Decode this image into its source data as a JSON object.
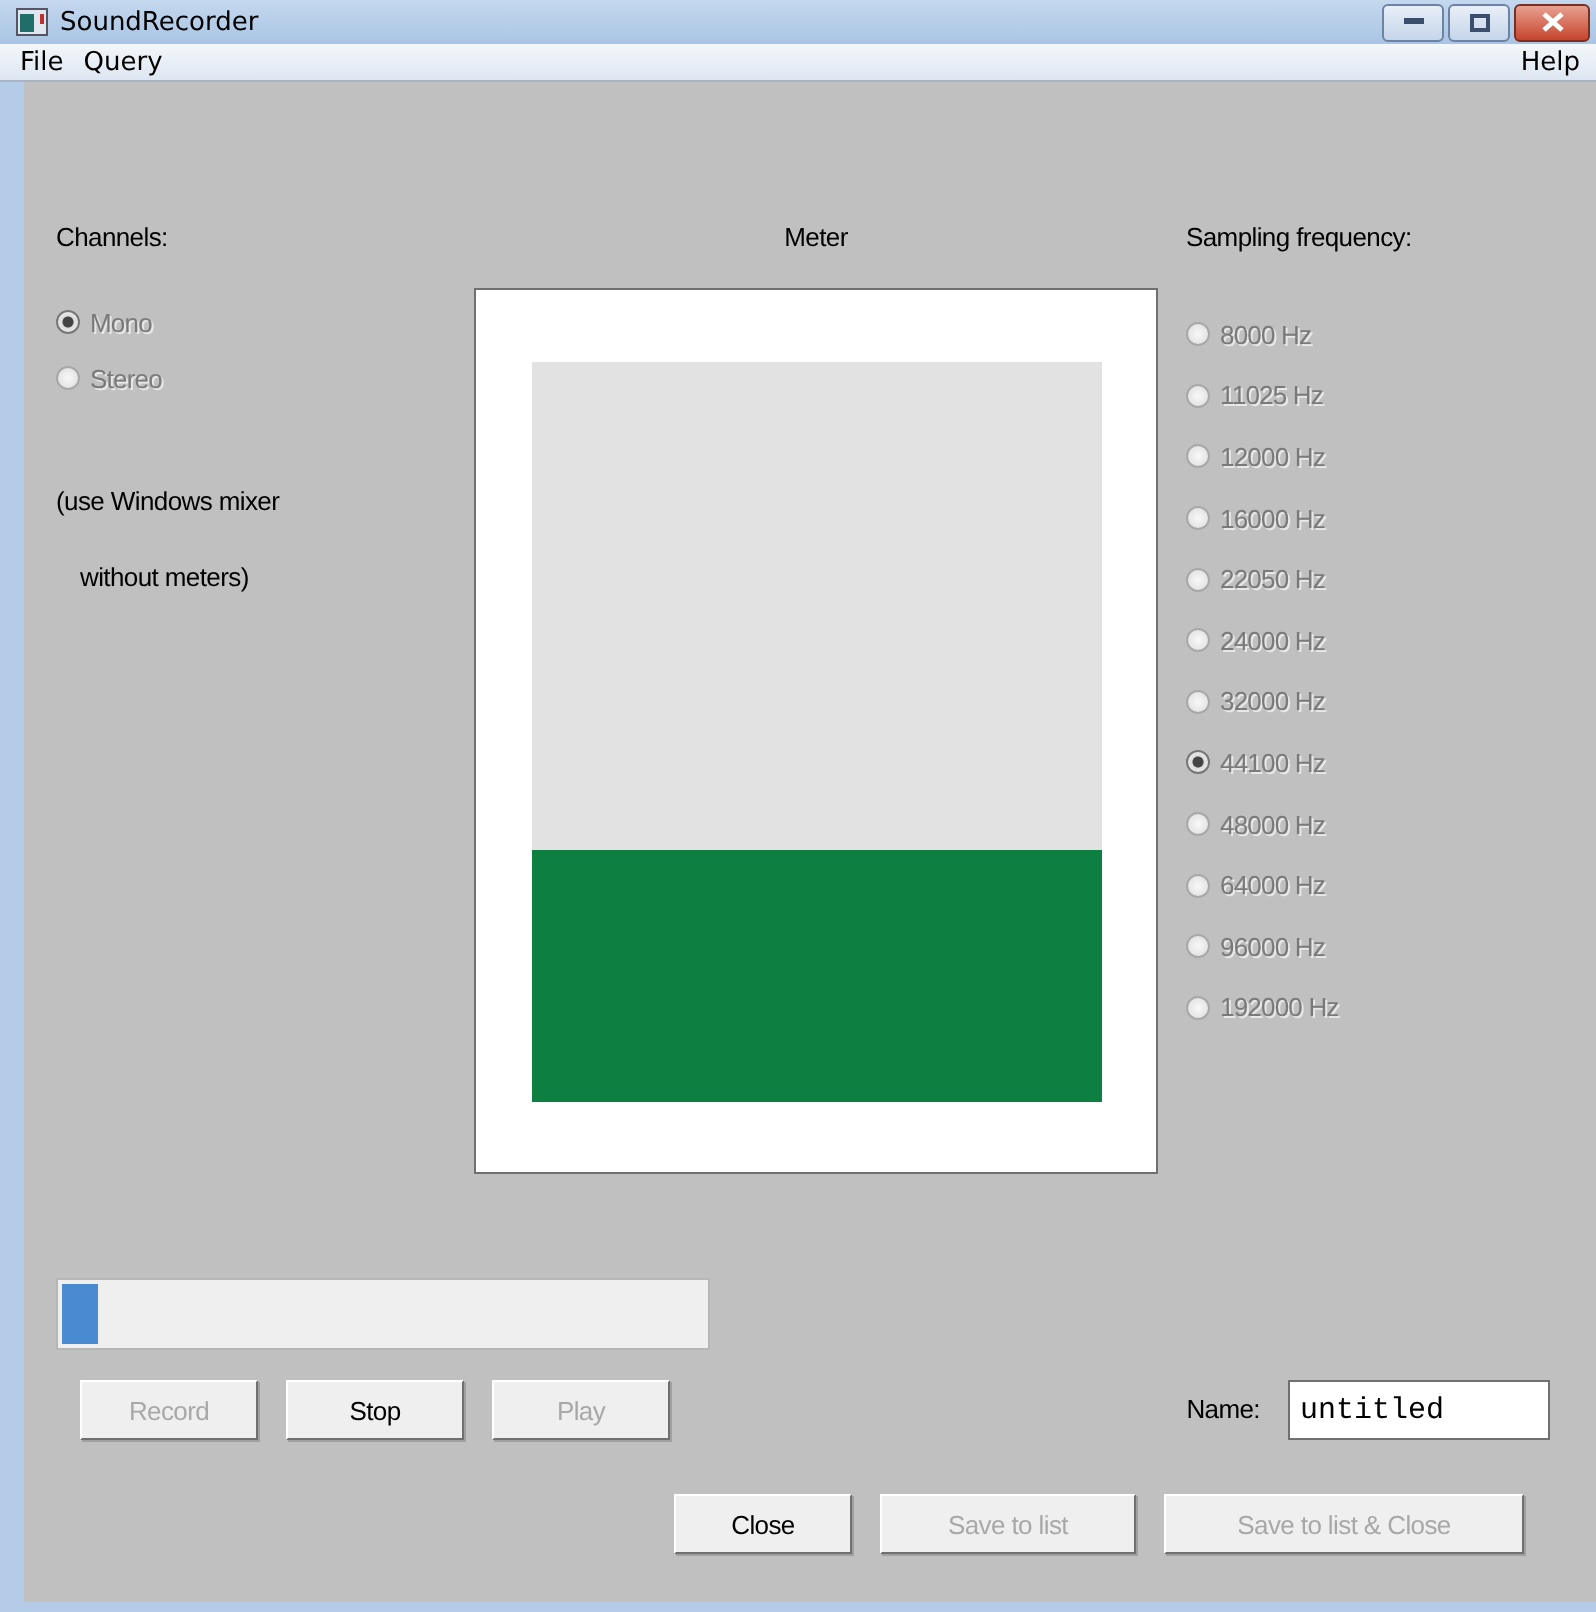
{
  "window": {
    "title": "SoundRecorder"
  },
  "menu": [
    "File",
    "Query"
  ],
  "help_menu": "Help",
  "channels": {
    "label": "Channels:",
    "options": [
      {
        "label": "Mono",
        "selected": true,
        "disabled": true
      },
      {
        "label": "Stereo",
        "selected": false,
        "disabled": true
      }
    ],
    "note": [
      "(use Windows mixer",
      "without meters)"
    ]
  },
  "meter": {
    "label": "Meter",
    "level": 0.34
  },
  "sampling": {
    "label": "Sampling frequency:",
    "options": [
      {
        "label": "8000 Hz",
        "selected": false,
        "disabled": true
      },
      {
        "label": "11025 Hz",
        "selected": false,
        "disabled": true
      },
      {
        "label": "12000 Hz",
        "selected": false,
        "disabled": true
      },
      {
        "label": "16000 Hz",
        "selected": false,
        "disabled": true
      },
      {
        "label": "22050 Hz",
        "selected": false,
        "disabled": true
      },
      {
        "label": "24000 Hz",
        "selected": false,
        "disabled": true
      },
      {
        "label": "32000 Hz",
        "selected": false,
        "disabled": true
      },
      {
        "label": "44100 Hz",
        "selected": true,
        "disabled": true
      },
      {
        "label": "48000 Hz",
        "selected": false,
        "disabled": true
      },
      {
        "label": "64000 Hz",
        "selected": false,
        "disabled": true
      },
      {
        "label": "96000 Hz",
        "selected": false,
        "disabled": true
      },
      {
        "label": "192000 Hz",
        "selected": false,
        "disabled": true
      }
    ]
  },
  "progress": {
    "level": 0.055
  },
  "transport_buttons": [
    {
      "label": "Record",
      "disabled": true
    },
    {
      "label": "Stop",
      "disabled": false
    },
    {
      "label": "Play",
      "disabled": true
    }
  ],
  "name_field": {
    "label": "Name:",
    "value": "untitled"
  },
  "dialog_buttons": [
    {
      "label": "Close",
      "disabled": false
    },
    {
      "label": "Save to list",
      "disabled": true
    },
    {
      "label": "Save to list & Close",
      "disabled": true
    }
  ]
}
